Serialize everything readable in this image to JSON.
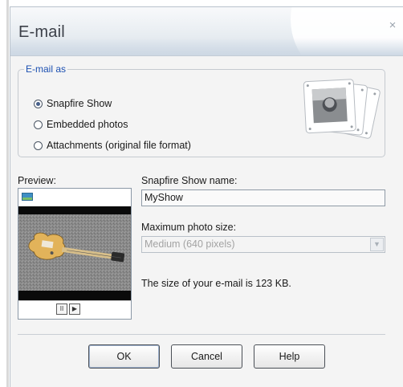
{
  "dialog": {
    "title": "E-mail",
    "close_glyph": "×"
  },
  "email_as": {
    "legend": "E-mail as",
    "options": [
      {
        "label": "Snapfire Show",
        "checked": true
      },
      {
        "label": "Embedded photos",
        "checked": false
      },
      {
        "label": "Attachments (original file format)",
        "checked": false
      }
    ]
  },
  "preview": {
    "label": "Preview:",
    "pause_glyph": "II",
    "play_glyph": "▶"
  },
  "show_name": {
    "label": "Snapfire Show name:",
    "value": "MyShow"
  },
  "photo_size": {
    "label": "Maximum photo size:",
    "value": "Medium (640 pixels)",
    "arrow_glyph": "▼",
    "disabled": true
  },
  "size_info": "The size of your e-mail is 123 KB.",
  "buttons": {
    "ok": "OK",
    "cancel": "Cancel",
    "help": "Help"
  },
  "icons": {
    "slides": "photo-slides-icon",
    "flag": "flag-icon"
  }
}
